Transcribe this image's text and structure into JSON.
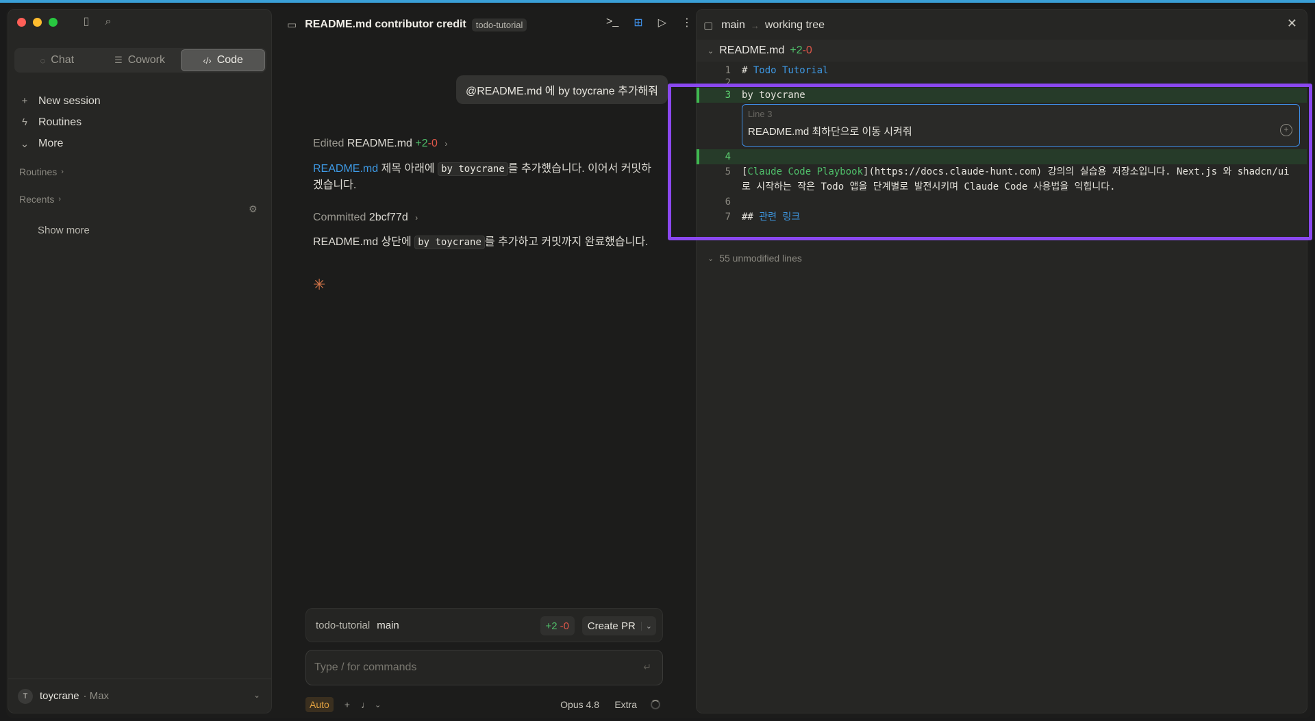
{
  "sidebar": {
    "modes": [
      {
        "label": "Chat",
        "icon": "chat-bubble-icon"
      },
      {
        "label": "Cowork",
        "icon": "checklist-icon"
      },
      {
        "label": "Code",
        "icon": "code-brackets-icon",
        "active": true
      }
    ],
    "nav": [
      {
        "label": "New session",
        "icon": "plus-icon"
      },
      {
        "label": "Routines",
        "icon": "bolt-icon"
      },
      {
        "label": "More",
        "icon": "chevron-down-icon"
      }
    ],
    "routines_header": "Routines",
    "recents_header": "Recents",
    "show_more": "Show more",
    "user": {
      "initial": "T",
      "name": "toycrane",
      "plan": "· Max"
    }
  },
  "chat": {
    "title": "README.md contributor credit",
    "repo_badge": "todo-tutorial",
    "user_message": "@README.md 에 by toycrane 추가해줘",
    "edited_prefix": "Edited",
    "edited_file": "README.md",
    "edited_plus": "+2",
    "edited_minus": "-0",
    "reply1_link": "README.md",
    "reply1_a": " 제목 아래에 ",
    "reply1_code": "by toycrane",
    "reply1_b": "를 추가했습니다. 이어서 커밋하겠습니다.",
    "committed_prefix": "Committed",
    "commit_hash": "2bcf77d",
    "reply2_a": "README.md 상단에 ",
    "reply2_code": "by toycrane",
    "reply2_b": "를 추가하고 커밋까지 완료했습니다.",
    "branch_bar": {
      "repo": "todo-tutorial",
      "branch": "main",
      "plus": "+2",
      "minus": "-0",
      "pr_label": "Create PR"
    },
    "composer_placeholder": "Type / for commands",
    "mode_badge": "Auto",
    "model": "Opus 4.8",
    "effort": "Extra"
  },
  "diff": {
    "branch": "main",
    "view": "working tree",
    "file": "README.md",
    "file_plus": "+2",
    "file_minus": "-0",
    "lines": [
      {
        "n": "1",
        "hash": "# ",
        "text": "Todo Tutorial"
      },
      {
        "n": "2",
        "text": ""
      },
      {
        "n": "3",
        "text": "by toycrane"
      },
      {
        "n": "4",
        "text": ""
      },
      {
        "n": "5",
        "link_text": "Claude Code Playbook",
        "rest": "(https://docs.claude-hunt.com) 강의의 실습용 저장소입니다. Next.js 와 shadcn/ui 로 시작하는 작은 Todo 앱을 단계별로 발전시키며 Claude Code 사용법을 익힙니다."
      },
      {
        "n": "6",
        "text": ""
      },
      {
        "n": "7",
        "hash": "## ",
        "text": "관련 링크"
      }
    ],
    "comment": {
      "label": "Line 3",
      "text": "README.md 최하단으로 이동 시켜줘"
    },
    "unmodified": "55 unmodified lines"
  },
  "colors": {
    "accent_blue": "#3e9ae6",
    "added_green": "#3fb950",
    "removed_red": "#e0574a",
    "highlight_purple": "#8b48f0"
  }
}
